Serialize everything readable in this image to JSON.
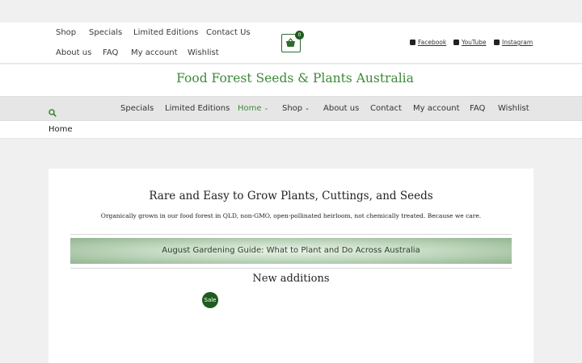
{
  "topbar": {
    "links": [
      "Shop",
      "Specials",
      "Limited Editions",
      "Contact Us",
      "About us",
      "FAQ",
      "My account",
      "Wishlist"
    ],
    "cart_count": "0",
    "social": [
      "Facebook",
      "YouTube",
      "Instagram"
    ]
  },
  "site": {
    "title": "Food Forest Seeds & Plants Australia",
    "accent": "#3d8b37",
    "dark_accent": "#1e5c1e"
  },
  "mainnav": {
    "items": [
      "Specials",
      "Limited Editions",
      "Home",
      "Shop",
      "About us",
      "Contact",
      "My account",
      "FAQ",
      "Wishlist"
    ],
    "active": "Home"
  },
  "breadcrumb": {
    "current": "Home"
  },
  "content": {
    "headline": "Rare and Easy to Grow Plants, Cuttings, and Seeds",
    "tagline": "Organically grown in our food forest in QLD, non-GMO, open-pollinated heirloom, not chemically treated. Because we care.",
    "guide_link": "August Gardening Guide: What to Plant and Do Across Australia",
    "new_additions": "New additions",
    "sale_badge": "Sale"
  }
}
